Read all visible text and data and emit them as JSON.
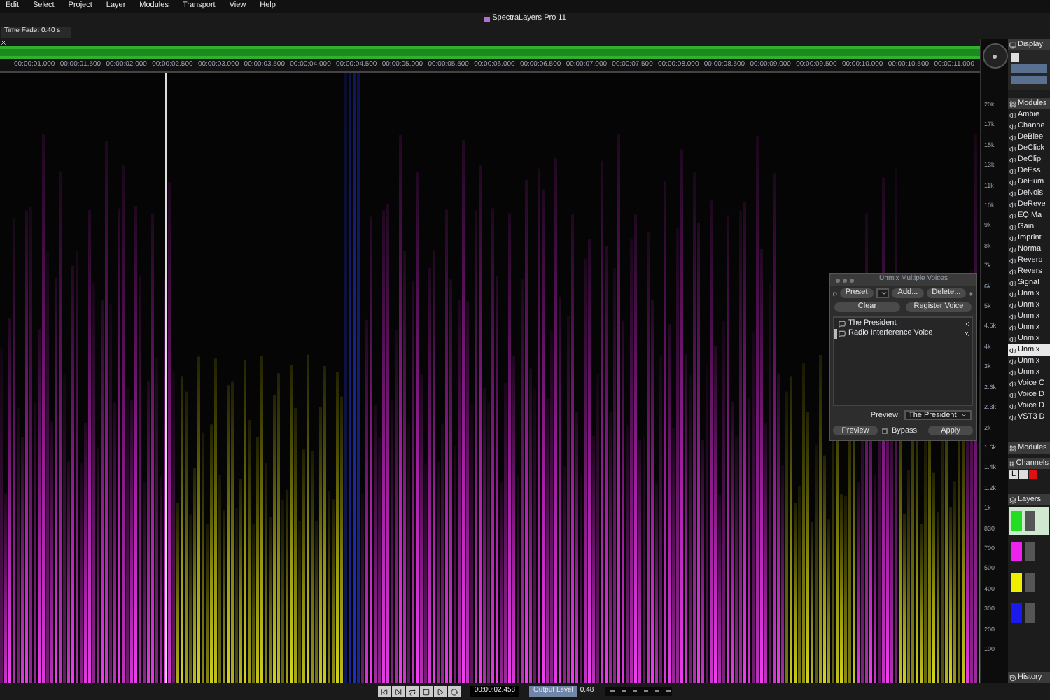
{
  "menu": [
    "Edit",
    "Select",
    "Project",
    "Layer",
    "Modules",
    "Transport",
    "View",
    "Help"
  ],
  "window": {
    "title": "SpectraLayers Pro 11"
  },
  "toolbar": {
    "time_fade": "Time Fade: 0.40 s"
  },
  "timeline": {
    "ticks": [
      "00:00:01.000",
      "00:00:01.500",
      "00:00:02.000",
      "00:00:02.500",
      "00:00:03.000",
      "00:00:03.500",
      "00:00:04.000",
      "00:00:04.500",
      "00:00:05.000",
      "00:00:05.500",
      "00:00:06.000",
      "00:00:06.500",
      "00:00:07.000",
      "00:00:07.500",
      "00:00:08.000",
      "00:00:08.500",
      "00:00:09.000",
      "00:00:09.500",
      "00:00:10.000",
      "00:00:10.500",
      "00:00:11.000"
    ]
  },
  "frequency_ruler": {
    "labels": [
      "20k",
      "17k",
      "15k",
      "13k",
      "11k",
      "10k",
      "9k",
      "8k",
      "7k",
      "6k",
      "5k",
      "4.5k",
      "4k",
      "3k",
      "2.6k",
      "2.3k",
      "2k",
      "1.6k",
      "1.4k",
      "1.2k",
      "1k",
      "830",
      "700",
      "500",
      "400",
      "300",
      "200",
      "100"
    ]
  },
  "dialog": {
    "title": "Unmix Multiple Voices",
    "preset_label": "Preset",
    "add": "Add...",
    "delete": "Delete...",
    "clear": "Clear",
    "register": "Register Voice",
    "voices": [
      {
        "name": "The President",
        "selected": false
      },
      {
        "name": "Radio Interference Voice",
        "selected": true
      }
    ],
    "preview_label": "Preview:",
    "preview_value": "The President",
    "preview_button": "Preview",
    "bypass": {
      "label": "Bypass",
      "checked": false
    },
    "apply": "Apply"
  },
  "panel": {
    "display": "Display",
    "modules_title": "Modules",
    "modules": [
      {
        "label": "Ambie",
        "selected": false
      },
      {
        "label": "Channe",
        "selected": false
      },
      {
        "label": "DeBlee",
        "selected": false
      },
      {
        "label": "DeClick",
        "selected": false
      },
      {
        "label": "DeClip",
        "selected": false
      },
      {
        "label": "DeEss",
        "selected": false
      },
      {
        "label": "DeHum",
        "selected": false
      },
      {
        "label": "DeNois",
        "selected": false
      },
      {
        "label": "DeReve",
        "selected": false
      },
      {
        "label": "EQ Ma",
        "selected": false
      },
      {
        "label": "Gain",
        "selected": false
      },
      {
        "label": "Imprint",
        "selected": false
      },
      {
        "label": "Norma",
        "selected": false
      },
      {
        "label": "Reverb",
        "selected": false
      },
      {
        "label": "Revers",
        "selected": false
      },
      {
        "label": "Signal",
        "selected": false
      },
      {
        "label": "Unmix",
        "selected": false
      },
      {
        "label": "Unmix",
        "selected": false
      },
      {
        "label": "Unmix",
        "selected": false
      },
      {
        "label": "Unmix",
        "selected": false
      },
      {
        "label": "Unmix",
        "selected": false
      },
      {
        "label": "Unmix",
        "selected": true
      },
      {
        "label": "Unmix",
        "selected": false
      },
      {
        "label": "Unmix",
        "selected": false
      },
      {
        "label": "Voice C",
        "selected": false
      },
      {
        "label": "Voice D",
        "selected": false
      },
      {
        "label": "Voice D",
        "selected": false
      },
      {
        "label": "VST3 D",
        "selected": false
      }
    ],
    "modules_title_2": "Modules",
    "channels_title": "Channels",
    "channel": "L",
    "layers_title": "Layers",
    "layers": [
      {
        "color": "#22dd22",
        "selected": true
      },
      {
        "color": "#ee22ee",
        "selected": false
      },
      {
        "color": "#eeee00",
        "selected": false
      },
      {
        "color": "#1a1aee",
        "selected": false
      }
    ],
    "history_title": "History"
  },
  "transport": {
    "time": "00:00:02.458",
    "output_label": "Output Level",
    "output_value": "0.48"
  }
}
